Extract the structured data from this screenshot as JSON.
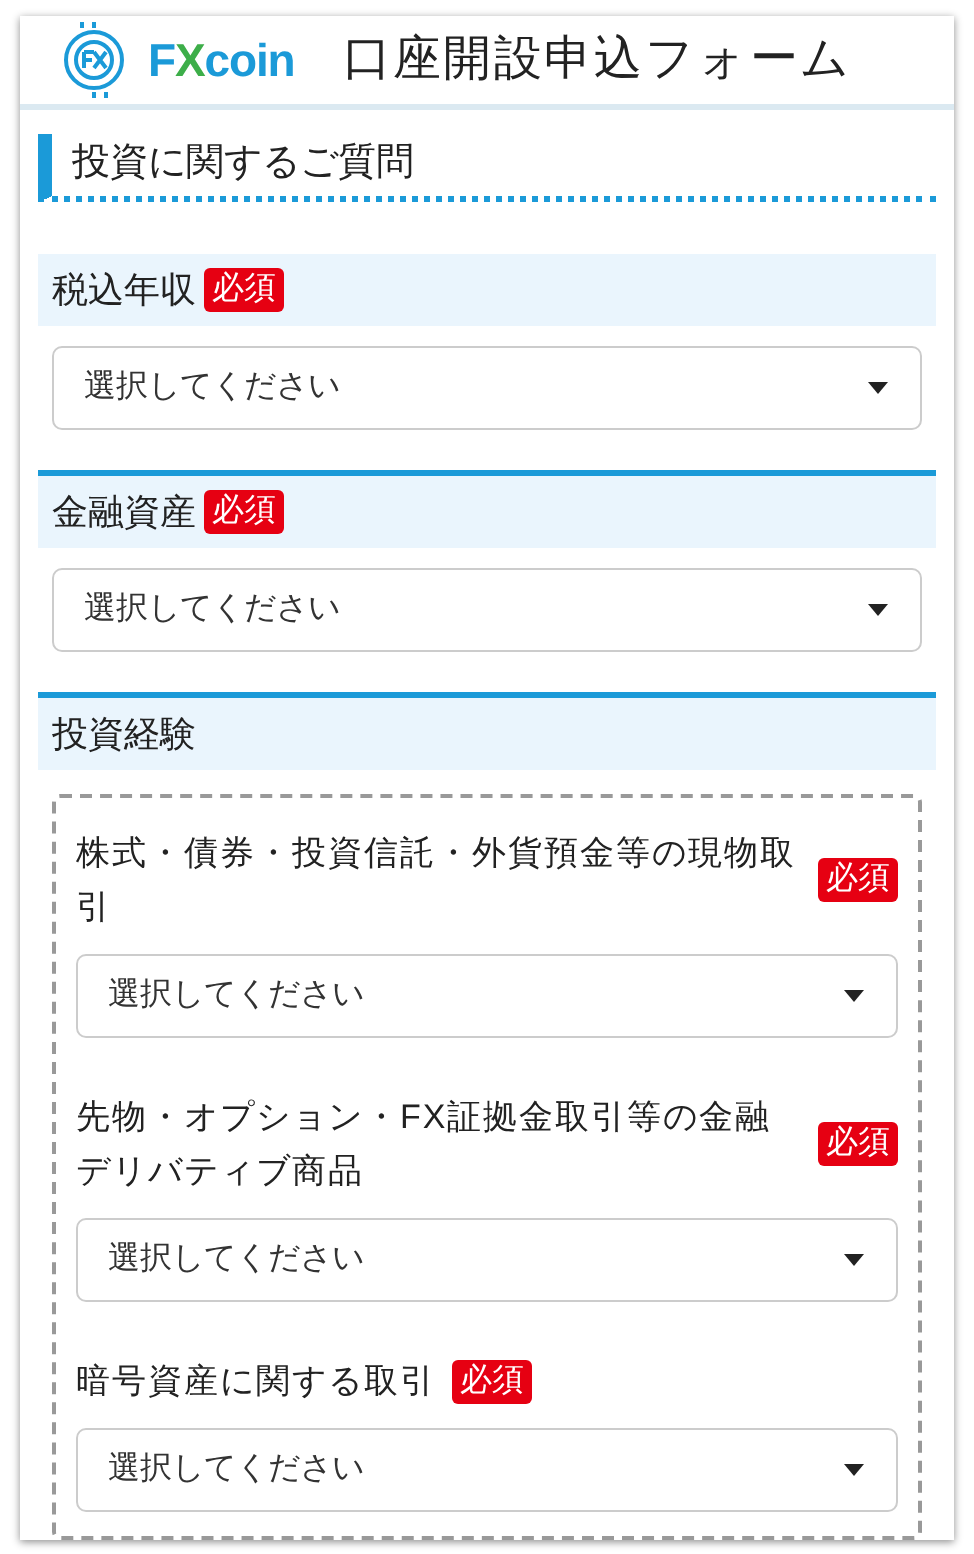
{
  "header": {
    "brand": [
      {
        "text": "F",
        "color": "#1b9ad8"
      },
      {
        "text": "X",
        "color": "#3dae49"
      },
      {
        "text": "coin",
        "color": "#1b9ad8"
      }
    ],
    "title": "口座開設申込フォーム"
  },
  "section_title": "投資に関するご質問",
  "groups": [
    {
      "kind": "select",
      "label": "税込年収",
      "required": true,
      "required_label": "必須",
      "placeholder": "選択してください"
    },
    {
      "kind": "select",
      "label": "金融資産",
      "required": true,
      "required_label": "必須",
      "placeholder": "選択してください"
    },
    {
      "kind": "nested",
      "label": "投資経験",
      "questions": [
        {
          "label": "株式・債券・投資信託・外貨預金等の現物取引",
          "required": true,
          "required_label": "必須",
          "placeholder": "選択してください"
        },
        {
          "label": "先物・オプション・FX証拠金取引等の金融デリバティブ商品",
          "required": true,
          "required_label": "必須",
          "placeholder": "選択してください"
        },
        {
          "label": "暗号資産に関する取引",
          "required": true,
          "required_label": "必須",
          "placeholder": "選択してください"
        }
      ]
    }
  ]
}
